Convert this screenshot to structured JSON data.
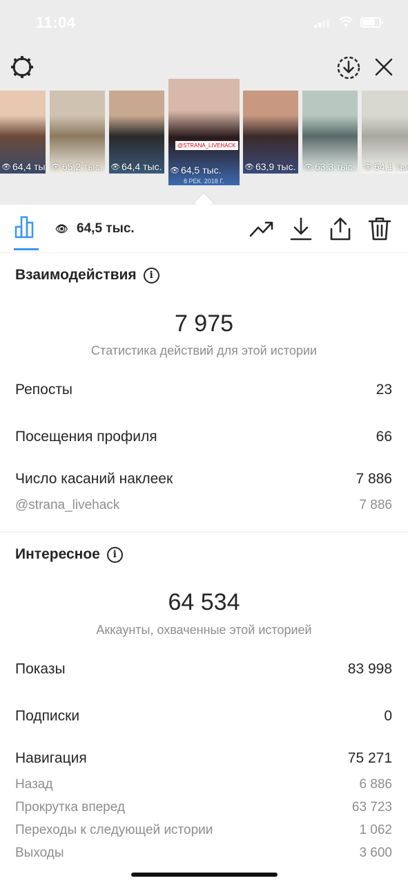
{
  "status_bar": {
    "time": "11:04"
  },
  "header": {
    "gear_icon": "settings-gear-icon",
    "download_icon": "download-circle-icon",
    "close_icon": "close-icon"
  },
  "stories": [
    {
      "views": "64,4 тыс.",
      "colors": [
        "#e8c8b0",
        "#6b4a3a",
        "#3a4a6a"
      ]
    },
    {
      "views": "65,2 тыс.",
      "colors": [
        "#cfc2b0",
        "#8b7a60",
        "#f0ece4"
      ]
    },
    {
      "views": "64,4 тыс.",
      "colors": [
        "#c8a890",
        "#2a2a2a",
        "#3a5a7a"
      ]
    },
    {
      "views": "64,5 тыс.",
      "subtitle": "8 РЕК. 2018 Г.",
      "sticker": "@STRANA_LIVEHACK",
      "colors": [
        "#d8b8a8",
        "#2a1a1a",
        "#3a6ab0"
      ]
    },
    {
      "views": "63,9 тыс.",
      "colors": [
        "#c89880",
        "#3a2a2a",
        "#3a4a7a"
      ]
    },
    {
      "views": "63,3 тыс.",
      "colors": [
        "#b8c8c0",
        "#5a6a68",
        "#e8f0ec"
      ]
    },
    {
      "views": "64,1 тыс.",
      "colors": [
        "#d8d8d0",
        "#a8a8a0",
        "#f4f4f0"
      ]
    }
  ],
  "toolbar": {
    "views_count": "64,5 тыс.",
    "icons": [
      "insights-bar-chart-icon",
      "trending-icon",
      "download-icon",
      "share-icon",
      "trash-icon"
    ]
  },
  "interactions": {
    "title": "Взаимодействия",
    "total": "7 975",
    "caption": "Статистика действий для этой истории",
    "rows": [
      {
        "label": "Репосты",
        "value": "23"
      },
      {
        "label": "Посещения профиля",
        "value": "66"
      },
      {
        "label": "Число касаний наклеек",
        "value": "7 886"
      }
    ],
    "sub_rows": [
      {
        "label": "@strana_livehack",
        "value": "7 886"
      }
    ]
  },
  "discovery": {
    "title": "Интересное",
    "total": "64 534",
    "caption": "Аккаунты, охваченные этой историей",
    "rows": [
      {
        "label": "Показы",
        "value": "83 998"
      },
      {
        "label": "Подписки",
        "value": "0"
      },
      {
        "label": "Навигация",
        "value": "75 271"
      }
    ],
    "sub_rows": [
      {
        "label": "Назад",
        "value": "6 886"
      },
      {
        "label": "Прокрутка вперед",
        "value": "63 723"
      },
      {
        "label": "Переходы к следующей истории",
        "value": "1 062"
      },
      {
        "label": "Выходы",
        "value": "3 600"
      }
    ]
  },
  "colors": {
    "accent": "#3897f0",
    "text": "#262626",
    "muted": "#8e8e8e"
  }
}
